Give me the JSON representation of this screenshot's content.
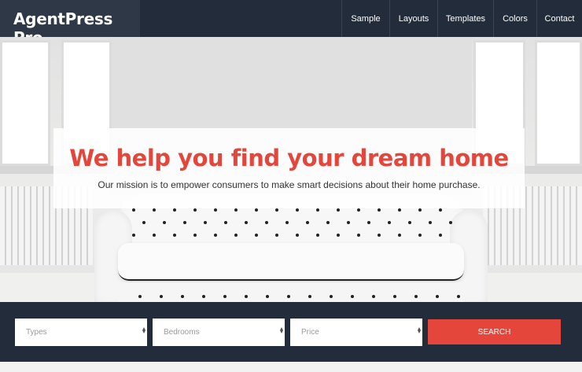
{
  "site": {
    "logo": "AgentPress Pro"
  },
  "nav": {
    "items": [
      {
        "label": "Sample"
      },
      {
        "label": "Layouts"
      },
      {
        "label": "Templates"
      },
      {
        "label": "Colors"
      },
      {
        "label": "Contact"
      }
    ]
  },
  "hero": {
    "headline": "We help you find your dream home",
    "subline": "Our mission is to empower consumers to make smart decisions about their home purchase."
  },
  "search": {
    "types": "Types",
    "bedrooms": "Bedrooms",
    "price": "Price",
    "button": "SEARCH"
  },
  "colors": {
    "accent": "#e4463c",
    "header_bg": "#232c3a",
    "logo_bg": "#2f3846"
  }
}
